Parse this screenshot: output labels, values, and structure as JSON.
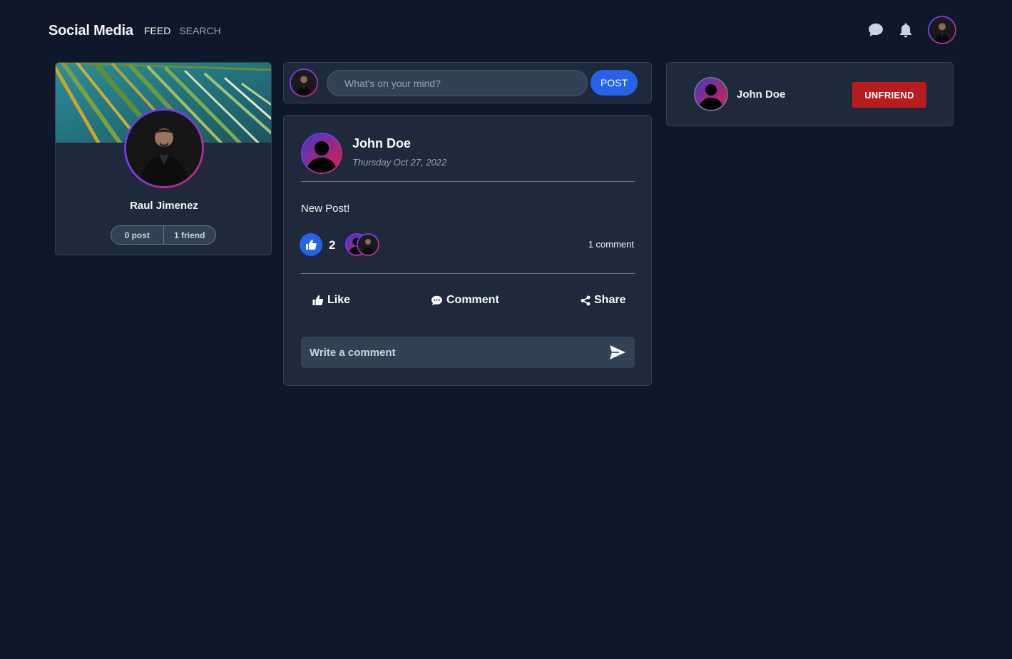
{
  "header": {
    "brand": "Social Media",
    "nav": [
      {
        "label": "FEED",
        "active": true
      },
      {
        "label": "SEARCH",
        "active": false
      }
    ],
    "icons": [
      "chat-bubble-icon",
      "bell-icon",
      "user-avatar"
    ]
  },
  "profile": {
    "name": "Raul Jimenez",
    "posts": "0 post",
    "friends": "1 friend"
  },
  "composer": {
    "placeholder": "What's on your mind?",
    "post_label": "POST"
  },
  "post": {
    "author": "John Doe",
    "date": "Thursday Oct 27, 2022",
    "body": "New Post!",
    "like_count": "2",
    "comment_count": "1 comment",
    "actions": {
      "like": "Like",
      "comment": "Comment",
      "share": "Share"
    },
    "comment_placeholder": "Write a comment"
  },
  "friend": {
    "name": "John Doe",
    "unfriend_label": "UNFRIEND"
  },
  "colors": {
    "background": "#0f172a",
    "card": "#1e293b",
    "accent": "#2563eb",
    "danger": "#b91c1c"
  }
}
